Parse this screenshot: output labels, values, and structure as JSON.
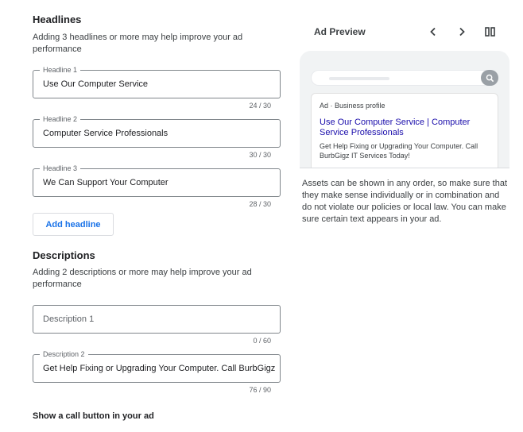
{
  "headlines": {
    "title": "Headlines",
    "help": "Adding 3 headlines or more may help improve your ad performance",
    "fields": [
      {
        "label": "Headline 1",
        "value": "Use Our Computer Service",
        "counter": "24 / 30"
      },
      {
        "label": "Headline 2",
        "value": "Computer Service Professionals",
        "counter": "30 / 30"
      },
      {
        "label": "Headline 3",
        "value": "We Can Support Your Computer",
        "counter": "28 / 30"
      }
    ],
    "add_label": "Add headline"
  },
  "descriptions": {
    "title": "Descriptions",
    "help": "Adding 2 descriptions or more may help improve your ad performance",
    "fields": [
      {
        "placeholder": "Description 1",
        "counter": "0 / 60"
      },
      {
        "label": "Description 2",
        "value": "Get Help Fixing or Upgrading Your Computer. Call BurbGigz IT",
        "counter": "76 / 90"
      }
    ]
  },
  "call": {
    "label": "Show a call button in your ad"
  },
  "preview": {
    "title": "Ad Preview",
    "icons": [
      "chevron-left-icon",
      "chevron-right-icon",
      "columns-icon"
    ],
    "ad": {
      "meta": "Ad · Business profile",
      "headline": "Use Our Computer Service | Computer Service Professionals",
      "description": "Get Help Fixing or Upgrading Your Computer. Call BurbGigz IT Services Today!"
    },
    "disclaimer": "Assets can be shown in any order, so make sure that they make sense individually or in combination and do not violate our policies or local law. You can make sure certain text appears in your ad."
  },
  "colors": {
    "accent": "#1a73e8",
    "ad_headline": "#1a0dab",
    "border": "#80868b"
  }
}
